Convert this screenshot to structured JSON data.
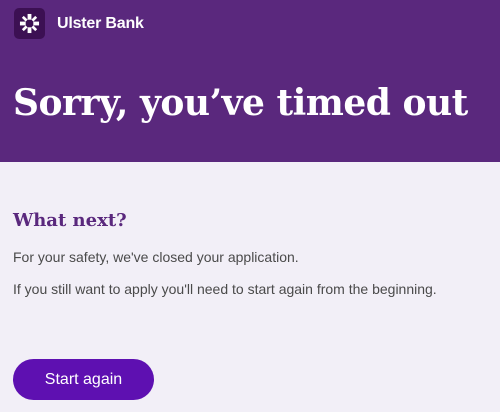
{
  "brand": {
    "name": "Ulster Bank",
    "logo_icon": "ulster-bank-logo-icon"
  },
  "header": {
    "title": "Sorry, you’ve timed out"
  },
  "main": {
    "heading": "What next?",
    "paragraphs": [
      "For your safety, we've closed your application.",
      "If you still want to apply you'll need to start again from the beginning."
    ],
    "start_again_label": "Start again"
  },
  "colors": {
    "header_bg": "#5a287d",
    "page_bg": "#f2eff7",
    "heading": "#5a287d",
    "button_bg": "#5e10b1"
  }
}
